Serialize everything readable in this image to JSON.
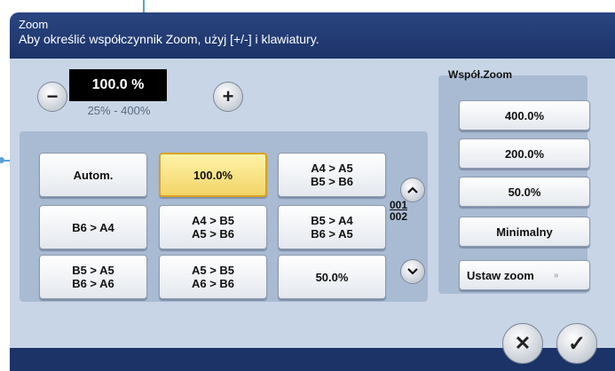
{
  "header": {
    "title": "Zoom",
    "message": "Aby określić współczynnik Zoom, użyj [+/-] i klawiatury."
  },
  "zoom": {
    "value": "100.0 %",
    "range": "25% - 400%",
    "minus_label": "−",
    "plus_label": "+"
  },
  "presets": [
    {
      "label": "Autom.",
      "active": false
    },
    {
      "label": "100.0%",
      "active": true
    },
    {
      "label": "A4 > A5\nB5 > B6",
      "active": false
    },
    {
      "label": "B6 > A4",
      "active": false
    },
    {
      "label": "A4 > B5\nA5 > B6",
      "active": false
    },
    {
      "label": "B5 > A4\nB6 > A5",
      "active": false
    },
    {
      "label": "B5 > A5\nB6 > A6",
      "active": false
    },
    {
      "label": "A5 > B5\nA6 > B6",
      "active": false
    },
    {
      "label": "50.0%",
      "active": false
    }
  ],
  "pager": {
    "current": "001",
    "total": "002"
  },
  "ratio": {
    "title": "Współ.Zoom",
    "items": [
      "400.0%",
      "200.0%",
      "50.0%",
      "Minimalny"
    ],
    "set_zoom_label": "Ustaw zoom",
    "set_zoom_arrow": "»"
  },
  "footer": {
    "cancel_glyph": "✕",
    "ok_glyph": "✓"
  },
  "colors": {
    "header": "#1c3368",
    "panel": "#a9bbd3",
    "active": "#f2d468",
    "callout": "#5aa2d6"
  }
}
